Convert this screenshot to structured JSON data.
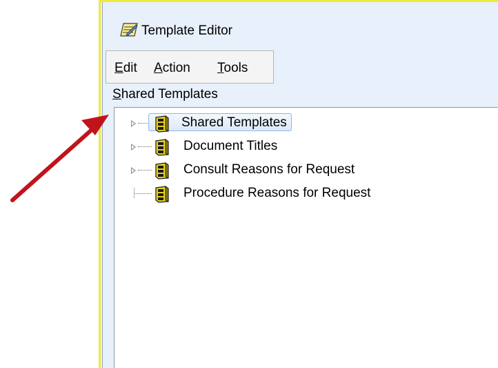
{
  "window": {
    "title": "Template Editor",
    "icon": "notepad-pencil-icon"
  },
  "menubar": {
    "items": [
      {
        "mnemonic": "E",
        "rest": "dit"
      },
      {
        "mnemonic": "A",
        "rest": "ction"
      },
      {
        "mnemonic": "T",
        "rest": "ools"
      }
    ]
  },
  "section": {
    "mnemonic": "S",
    "rest": "hared Templates"
  },
  "tree": {
    "nodes": [
      {
        "label": "Shared Templates",
        "expandable": true,
        "selected": true
      },
      {
        "label": "Document Titles",
        "expandable": true,
        "selected": false
      },
      {
        "label": "Consult Reasons for Request",
        "expandable": true,
        "selected": false
      },
      {
        "label": "Procedure Reasons for Request",
        "expandable": false,
        "selected": false
      }
    ],
    "node_icon": "book-stack-icon"
  },
  "annotation": {
    "arrow_color": "#c0141c"
  },
  "colors": {
    "window_bg": "#e8f0fb",
    "window_border_highlight": "#f2ea3a",
    "selection_border": "#8fb8e8"
  }
}
